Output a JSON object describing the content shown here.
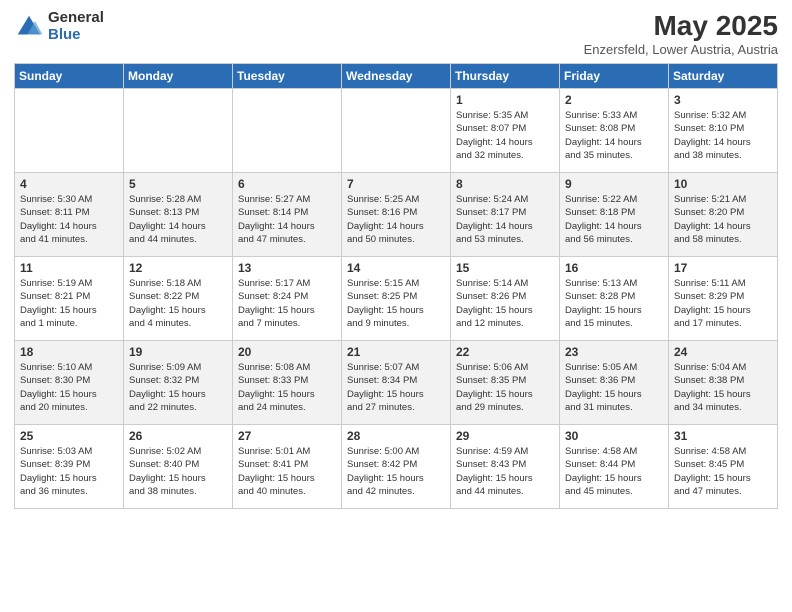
{
  "logo": {
    "general": "General",
    "blue": "Blue"
  },
  "header": {
    "title": "May 2025",
    "subtitle": "Enzersfeld, Lower Austria, Austria"
  },
  "days_of_week": [
    "Sunday",
    "Monday",
    "Tuesday",
    "Wednesday",
    "Thursday",
    "Friday",
    "Saturday"
  ],
  "weeks": [
    [
      {
        "day": "",
        "info": ""
      },
      {
        "day": "",
        "info": ""
      },
      {
        "day": "",
        "info": ""
      },
      {
        "day": "",
        "info": ""
      },
      {
        "day": "1",
        "info": "Sunrise: 5:35 AM\nSunset: 8:07 PM\nDaylight: 14 hours\nand 32 minutes."
      },
      {
        "day": "2",
        "info": "Sunrise: 5:33 AM\nSunset: 8:08 PM\nDaylight: 14 hours\nand 35 minutes."
      },
      {
        "day": "3",
        "info": "Sunrise: 5:32 AM\nSunset: 8:10 PM\nDaylight: 14 hours\nand 38 minutes."
      }
    ],
    [
      {
        "day": "4",
        "info": "Sunrise: 5:30 AM\nSunset: 8:11 PM\nDaylight: 14 hours\nand 41 minutes."
      },
      {
        "day": "5",
        "info": "Sunrise: 5:28 AM\nSunset: 8:13 PM\nDaylight: 14 hours\nand 44 minutes."
      },
      {
        "day": "6",
        "info": "Sunrise: 5:27 AM\nSunset: 8:14 PM\nDaylight: 14 hours\nand 47 minutes."
      },
      {
        "day": "7",
        "info": "Sunrise: 5:25 AM\nSunset: 8:16 PM\nDaylight: 14 hours\nand 50 minutes."
      },
      {
        "day": "8",
        "info": "Sunrise: 5:24 AM\nSunset: 8:17 PM\nDaylight: 14 hours\nand 53 minutes."
      },
      {
        "day": "9",
        "info": "Sunrise: 5:22 AM\nSunset: 8:18 PM\nDaylight: 14 hours\nand 56 minutes."
      },
      {
        "day": "10",
        "info": "Sunrise: 5:21 AM\nSunset: 8:20 PM\nDaylight: 14 hours\nand 58 minutes."
      }
    ],
    [
      {
        "day": "11",
        "info": "Sunrise: 5:19 AM\nSunset: 8:21 PM\nDaylight: 15 hours\nand 1 minute."
      },
      {
        "day": "12",
        "info": "Sunrise: 5:18 AM\nSunset: 8:22 PM\nDaylight: 15 hours\nand 4 minutes."
      },
      {
        "day": "13",
        "info": "Sunrise: 5:17 AM\nSunset: 8:24 PM\nDaylight: 15 hours\nand 7 minutes."
      },
      {
        "day": "14",
        "info": "Sunrise: 5:15 AM\nSunset: 8:25 PM\nDaylight: 15 hours\nand 9 minutes."
      },
      {
        "day": "15",
        "info": "Sunrise: 5:14 AM\nSunset: 8:26 PM\nDaylight: 15 hours\nand 12 minutes."
      },
      {
        "day": "16",
        "info": "Sunrise: 5:13 AM\nSunset: 8:28 PM\nDaylight: 15 hours\nand 15 minutes."
      },
      {
        "day": "17",
        "info": "Sunrise: 5:11 AM\nSunset: 8:29 PM\nDaylight: 15 hours\nand 17 minutes."
      }
    ],
    [
      {
        "day": "18",
        "info": "Sunrise: 5:10 AM\nSunset: 8:30 PM\nDaylight: 15 hours\nand 20 minutes."
      },
      {
        "day": "19",
        "info": "Sunrise: 5:09 AM\nSunset: 8:32 PM\nDaylight: 15 hours\nand 22 minutes."
      },
      {
        "day": "20",
        "info": "Sunrise: 5:08 AM\nSunset: 8:33 PM\nDaylight: 15 hours\nand 24 minutes."
      },
      {
        "day": "21",
        "info": "Sunrise: 5:07 AM\nSunset: 8:34 PM\nDaylight: 15 hours\nand 27 minutes."
      },
      {
        "day": "22",
        "info": "Sunrise: 5:06 AM\nSunset: 8:35 PM\nDaylight: 15 hours\nand 29 minutes."
      },
      {
        "day": "23",
        "info": "Sunrise: 5:05 AM\nSunset: 8:36 PM\nDaylight: 15 hours\nand 31 minutes."
      },
      {
        "day": "24",
        "info": "Sunrise: 5:04 AM\nSunset: 8:38 PM\nDaylight: 15 hours\nand 34 minutes."
      }
    ],
    [
      {
        "day": "25",
        "info": "Sunrise: 5:03 AM\nSunset: 8:39 PM\nDaylight: 15 hours\nand 36 minutes."
      },
      {
        "day": "26",
        "info": "Sunrise: 5:02 AM\nSunset: 8:40 PM\nDaylight: 15 hours\nand 38 minutes."
      },
      {
        "day": "27",
        "info": "Sunrise: 5:01 AM\nSunset: 8:41 PM\nDaylight: 15 hours\nand 40 minutes."
      },
      {
        "day": "28",
        "info": "Sunrise: 5:00 AM\nSunset: 8:42 PM\nDaylight: 15 hours\nand 42 minutes."
      },
      {
        "day": "29",
        "info": "Sunrise: 4:59 AM\nSunset: 8:43 PM\nDaylight: 15 hours\nand 44 minutes."
      },
      {
        "day": "30",
        "info": "Sunrise: 4:58 AM\nSunset: 8:44 PM\nDaylight: 15 hours\nand 45 minutes."
      },
      {
        "day": "31",
        "info": "Sunrise: 4:58 AM\nSunset: 8:45 PM\nDaylight: 15 hours\nand 47 minutes."
      }
    ]
  ]
}
